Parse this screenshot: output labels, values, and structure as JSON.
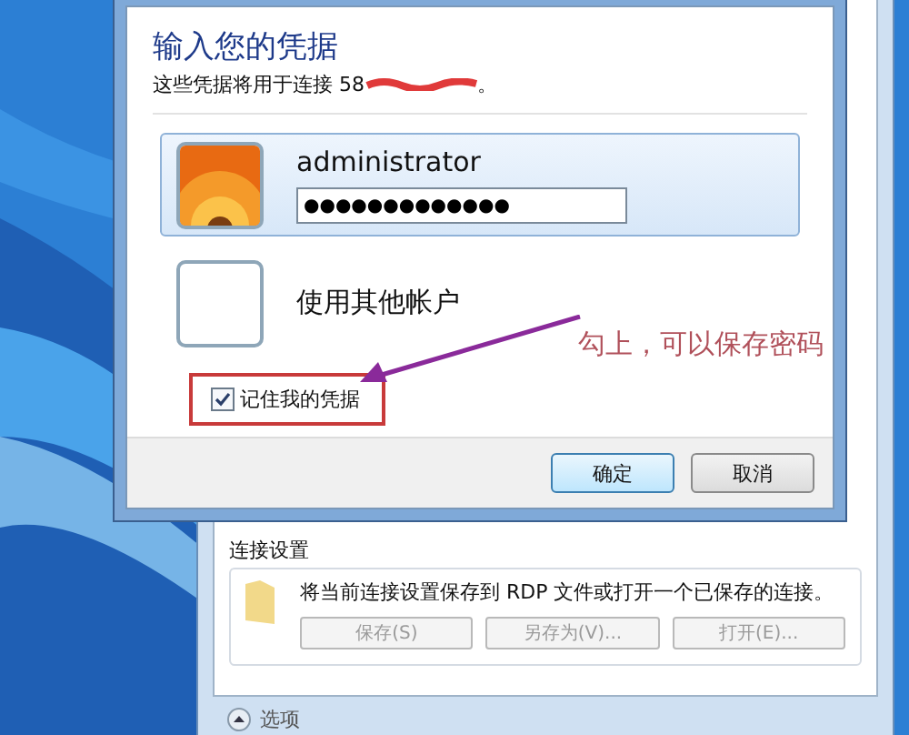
{
  "dialog": {
    "heading": "输入您的凭据",
    "subtitle": "这些凭据将用于连接 58",
    "subtitle_end": "。",
    "accounts": [
      {
        "kind": "user",
        "name": "administrator",
        "password": "●●●●●●●●●●●●●",
        "selected": true
      },
      {
        "kind": "other",
        "name": "使用其他帐户",
        "selected": false
      }
    ],
    "remember": {
      "label": "记住我的凭据",
      "checked": true
    },
    "buttons": [
      "确定",
      "取消"
    ]
  },
  "annotation": {
    "text": "勾上，可以保存密码"
  },
  "background_window": {
    "group_title": "连接设置",
    "group_text": "将当前连接设置保存到 RDP 文件或打开一个已保存的连接。",
    "buttons": [
      "保存(S)",
      "另存为(V)...",
      "打开(E)..."
    ],
    "options": "选项"
  }
}
